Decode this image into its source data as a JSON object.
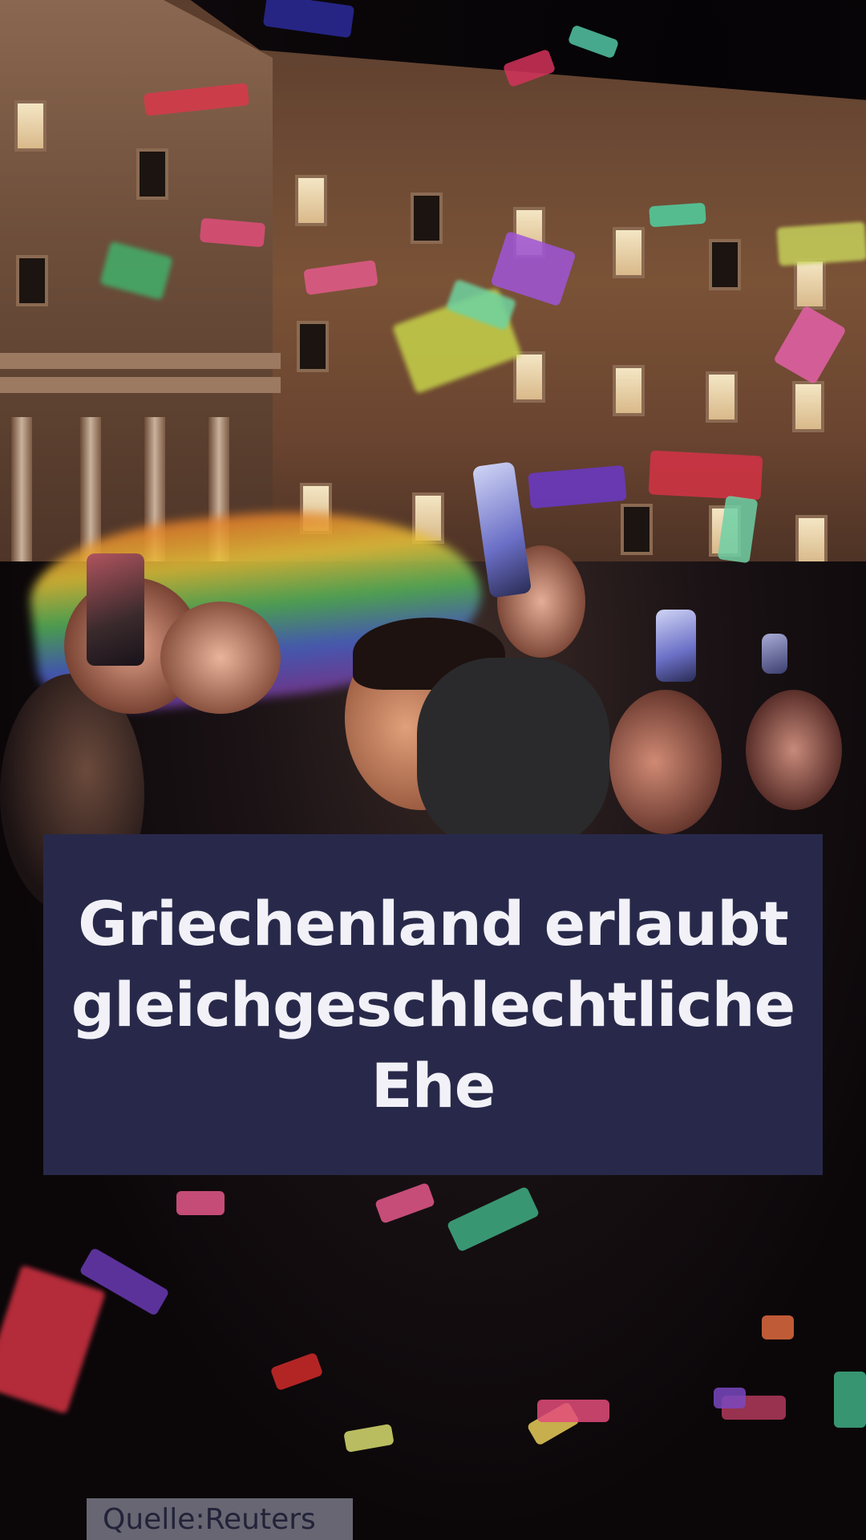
{
  "headline": {
    "line1": "Griechenland erlaubt",
    "line2": "gleichgeschlechtliche",
    "line3": "Ehe"
  },
  "source": {
    "label": "Quelle:",
    "name": "Reuters"
  },
  "colors": {
    "headline_box": "#28294a",
    "headline_text": "#f1f1f7",
    "source_box": "#6c6c78",
    "source_text": "#24243c"
  }
}
